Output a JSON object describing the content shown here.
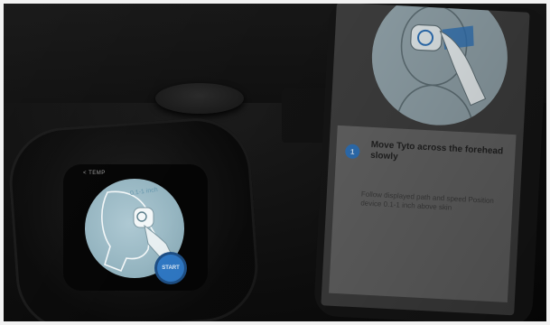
{
  "device": {
    "back_label": "< TEMP",
    "hint_text": "0.1-1 inch",
    "start_label": "START"
  },
  "phone": {
    "step_number": "1",
    "step_title": "Move Tyto across the forehead slowly",
    "step_body": "Follow displayed path and speed Position device 0.1-1 inch above skin"
  },
  "colors": {
    "accent_blue": "#2f78c4",
    "screen_teal": "#aec9d3"
  }
}
